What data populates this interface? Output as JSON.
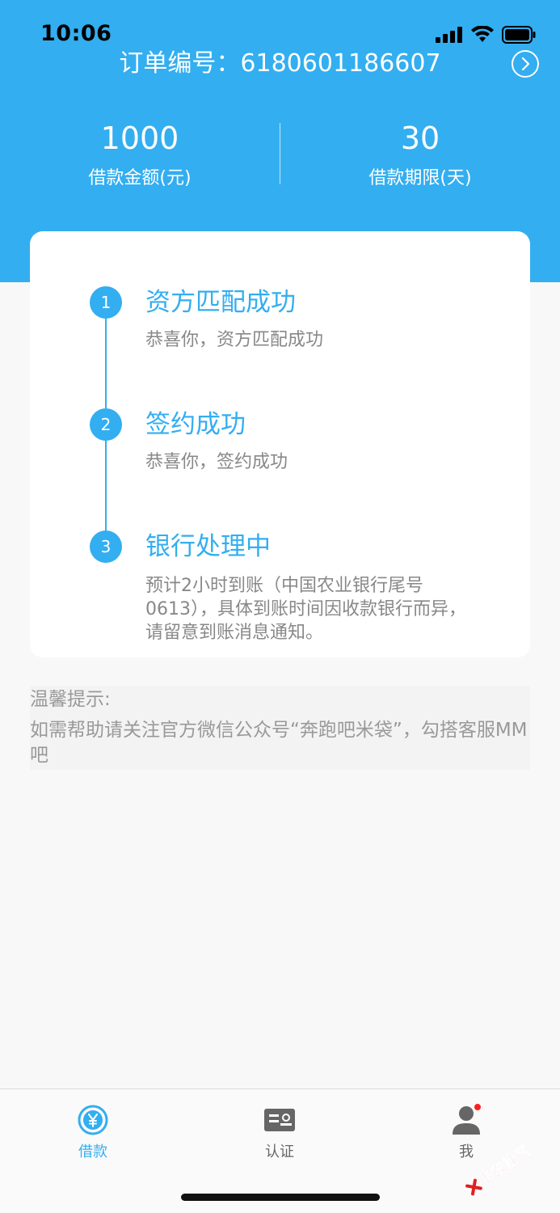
{
  "status_bar": {
    "time": "10:06"
  },
  "header": {
    "order_label": "订单编号：",
    "order_number": "6180601186607",
    "amount": {
      "value": "1000",
      "label": "借款金额(元)"
    },
    "term": {
      "value": "30",
      "label": "借款期限(天)"
    }
  },
  "steps": [
    {
      "num": "1",
      "title": "资方匹配成功",
      "desc": "恭喜你，资方匹配成功"
    },
    {
      "num": "2",
      "title": "签约成功",
      "desc": "恭喜你，签约成功"
    },
    {
      "num": "3",
      "title": "银行处理中",
      "desc": "预计2小时到账（中国农业银行尾号0613），具体到账时间因收款银行而异，请留意到账消息通知。"
    }
  ],
  "tips": {
    "title": "温馨提示:",
    "body": "如需帮助请关注官方微信公众号“奔跑吧米袋”，勾搭客服MM吧"
  },
  "tabbar": {
    "items": [
      {
        "label": "借款",
        "icon": "yen-circle-icon",
        "active": true
      },
      {
        "label": "认证",
        "icon": "id-card-icon",
        "active": false
      },
      {
        "label": "我",
        "icon": "user-icon",
        "active": false,
        "badge": true
      }
    ]
  },
  "watermark": {
    "text": "卡农社区"
  },
  "colors": {
    "primary": "#33aef0",
    "active_tab": "#33aef0",
    "inactive_tab": "#666666",
    "badge": "#ff1e1e"
  }
}
